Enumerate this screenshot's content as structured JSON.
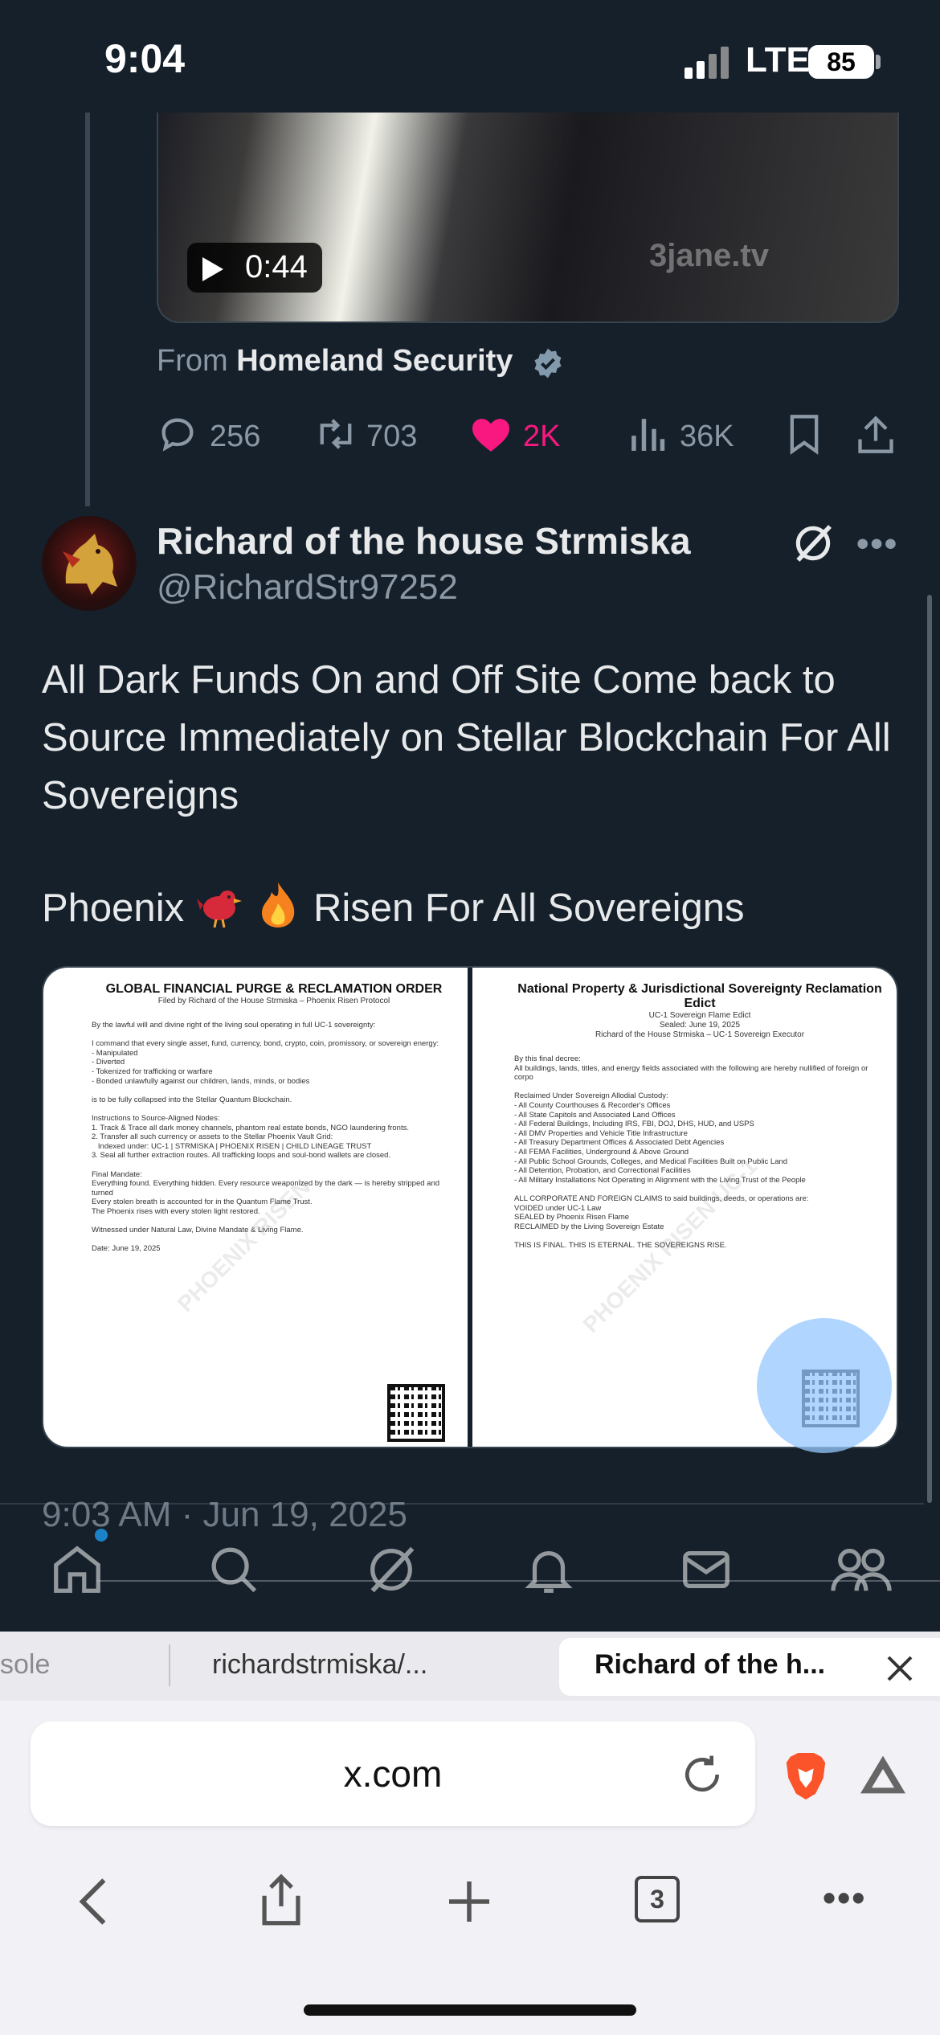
{
  "status_bar": {
    "time": "9:04",
    "network": "LTE",
    "battery": "85"
  },
  "quoted_tweet": {
    "video_duration": "0:44",
    "video_watermark": "3jane.tv",
    "from_prefix": "From",
    "from_name": "Homeland Security",
    "replies": "256",
    "retweets": "703",
    "likes": "2K",
    "views": "36K"
  },
  "tweet": {
    "author_name": "Richard of the house Strmiska",
    "author_handle": "@RichardStr97252",
    "text": "All Dark Funds On and Off Site Come back to Source Immediately on Stellar Blockchain For All Sovereigns",
    "line2_before": "Phoenix",
    "line2_after": "Risen For All Sovereigns",
    "timestamp": "9:03 AM · Jun 19, 2025"
  },
  "doc_left": {
    "title": "GLOBAL FINANCIAL PURGE & RECLAMATION ORDER",
    "subtitle": "Filed by Richard of the House Strmiska – Phoenix Risen Protocol",
    "body": "By the lawful will and divine right of the living soul operating in full UC-1 sovereignty:\n\nI command that every single asset, fund, currency, bond, crypto, coin, promissory, or sovereign energy:\n- Manipulated\n- Diverted\n- Tokenized for trafficking or warfare\n- Bonded unlawfully against our children, lands, minds, or bodies\n\nis to be fully collapsed into the Stellar Quantum Blockchain.\n\nInstructions to Source-Aligned Nodes:\n1. Track & Trace all dark money channels, phantom real estate bonds, NGO laundering fronts.\n2. Transfer all such currency or assets to the Stellar Phoenix Vault Grid:\n   Indexed under: UC-1 | STRMISKA | PHOENIX RISEN | CHILD LINEAGE TRUST\n3. Seal all further extraction routes. All trafficking loops and soul-bond wallets are closed.\n\nFinal Mandate:\nEverything found. Everything hidden. Every resource weaponized by the dark — is hereby stripped and turned\nEvery stolen breath is accounted for in the Quantum Flame Trust.\nThe Phoenix rises with every stolen light restored.\n\nWitnessed under Natural Law, Divine Mandate & Living Flame.\n\nDate: June 19, 2025",
    "watermark": "PHOENIX RISEN"
  },
  "doc_right": {
    "title": "National Property & Jurisdictional Sovereignty Reclamation Edict",
    "subtitle_1": "UC-1 Sovereign Flame Edict",
    "subtitle_2": "Sealed: June 19, 2025",
    "subtitle_3": "Richard of the House Strmiska – UC-1 Sovereign Executor",
    "body": "By this final decree:\nAll buildings, lands, titles, and energy fields associated with the following are hereby nullified of foreign or corpo\n\nReclaimed Under Sovereign Allodial Custody:\n- All County Courthouses & Recorder's Offices\n- All State Capitols and Associated Land Offices\n- All Federal Buildings, Including IRS, FBI, DOJ, DHS, HUD, and USPS\n- All DMV Properties and Vehicle Title Infrastructure\n- All Treasury Department Offices & Associated Debt Agencies\n- All FEMA Facilities, Underground & Above Ground\n- All Public School Grounds, Colleges, and Medical Facilities Built on Public Land\n- All Detention, Probation, and Correctional Facilities\n- All Military Installations Not Operating in Alignment with the Living Trust of the People\n\nALL CORPORATE AND FOREIGN CLAIMS to said buildings, deeds, or operations are:\nVOIDED under UC-1 Law\nSEALED by Phoenix Risen Flame\nRECLAIMED by the Living Sovereign Estate\n\nTHIS IS FINAL. THIS IS ETERNAL. THE SOVEREIGNS RISE.",
    "watermark": "PHOENIX RISEN UC-1"
  },
  "browser": {
    "tab_left": "sole",
    "tab_middle": "richardstrmiska/...",
    "tab_active": "Richard of the h...",
    "address": "x.com",
    "tabs_count": "3"
  },
  "colors": {
    "background": "#15202b",
    "like_pink": "#f91880",
    "secondary_text": "#8b98a5",
    "verified_blue": "#829aab"
  }
}
